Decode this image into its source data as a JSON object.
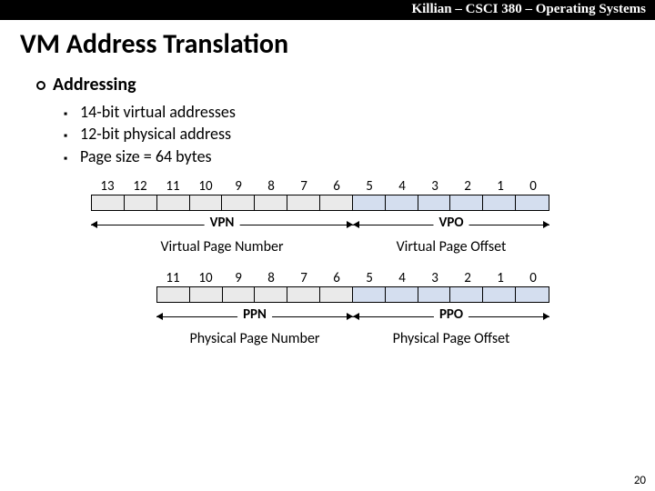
{
  "header": "Killian – CSCI 380 – Operating Systems",
  "title": "VM Address Translation",
  "section": "Addressing",
  "bullets": {
    "b0": "14-bit virtual addresses",
    "b1": "12-bit physical address",
    "b2": "Page size = 64 bytes"
  },
  "virtual_bits": [
    "13",
    "12",
    "11",
    "10",
    "9",
    "8",
    "7",
    "6",
    "5",
    "4",
    "3",
    "2",
    "1",
    "0"
  ],
  "physical_bits": [
    "11",
    "10",
    "9",
    "8",
    "7",
    "6",
    "5",
    "4",
    "3",
    "2",
    "1",
    "0"
  ],
  "vpn_label": "VPN",
  "vpo_label": "VPO",
  "vpn_desc": "Virtual Page Number",
  "vpo_desc": "Virtual Page Offset",
  "ppn_label": "PPN",
  "ppo_label": "PPO",
  "ppn_desc": "Physical Page Number",
  "ppo_desc": "Physical Page Offset",
  "page_number": "20",
  "colors": {
    "region_a": "#eaeaea",
    "region_b": "#d4deef"
  },
  "chart_data": [
    {
      "type": "table",
      "title": "Virtual address bit layout (14 bits)",
      "bits": [
        13,
        12,
        11,
        10,
        9,
        8,
        7,
        6,
        5,
        4,
        3,
        2,
        1,
        0
      ],
      "fields": [
        {
          "name": "VPN",
          "description": "Virtual Page Number",
          "bit_hi": 13,
          "bit_lo": 6
        },
        {
          "name": "VPO",
          "description": "Virtual Page Offset",
          "bit_hi": 5,
          "bit_lo": 0
        }
      ]
    },
    {
      "type": "table",
      "title": "Physical address bit layout (12 bits)",
      "bits": [
        11,
        10,
        9,
        8,
        7,
        6,
        5,
        4,
        3,
        2,
        1,
        0
      ],
      "fields": [
        {
          "name": "PPN",
          "description": "Physical Page Number",
          "bit_hi": 11,
          "bit_lo": 6
        },
        {
          "name": "PPO",
          "description": "Physical Page Offset",
          "bit_hi": 5,
          "bit_lo": 0
        }
      ]
    }
  ]
}
